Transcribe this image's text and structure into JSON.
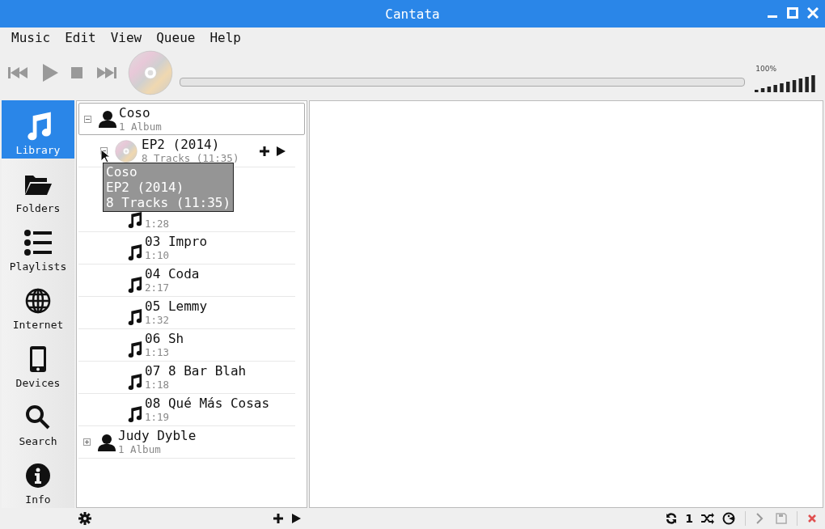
{
  "window": {
    "title": "Cantata"
  },
  "menu": [
    "Music",
    "Edit",
    "View",
    "Queue",
    "Help"
  ],
  "position": {
    "level": 0
  },
  "volume": {
    "reading": "100%",
    "level": 1
  },
  "sidebar": {
    "items": [
      {
        "label": "Library",
        "selected": true
      },
      {
        "label": "Folders",
        "selected": false
      },
      {
        "label": "Playlists",
        "selected": false
      },
      {
        "label": "Internet",
        "selected": false
      },
      {
        "label": "Devices",
        "selected": false
      },
      {
        "label": "Search",
        "selected": false
      },
      {
        "label": "Info",
        "selected": false
      }
    ]
  },
  "library": {
    "artists": [
      {
        "name": "Coso",
        "info": "1 Album",
        "expanded": true,
        "selected": true,
        "children": [
          {
            "title": "EP2 (2014)",
            "info": "8 Tracks (11:35)",
            "expanded": true,
            "hovered": true,
            "children": [
              {
                "duration": "1:28"
              },
              {
                "title": "03 Impro",
                "duration": "1:10"
              },
              {
                "title": "04 Coda",
                "duration": "2:17"
              },
              {
                "title": "05 Lemmy",
                "duration": "1:32"
              },
              {
                "title": "06 Sh",
                "duration": "1:13"
              },
              {
                "title": "07 8 Bar Blah",
                "duration": "1:18"
              },
              {
                "title": "08 Qué Más Cosas",
                "duration": "1:19"
              }
            ]
          }
        ]
      },
      {
        "name": "Judy Dyble",
        "info": "1 Album",
        "expanded": false,
        "selected": false
      }
    ],
    "tooltip": [
      "Coso",
      "EP2 (2014)",
      "8 Tracks (11:35)"
    ]
  },
  "status_bar": {
    "single_mode": "1"
  }
}
